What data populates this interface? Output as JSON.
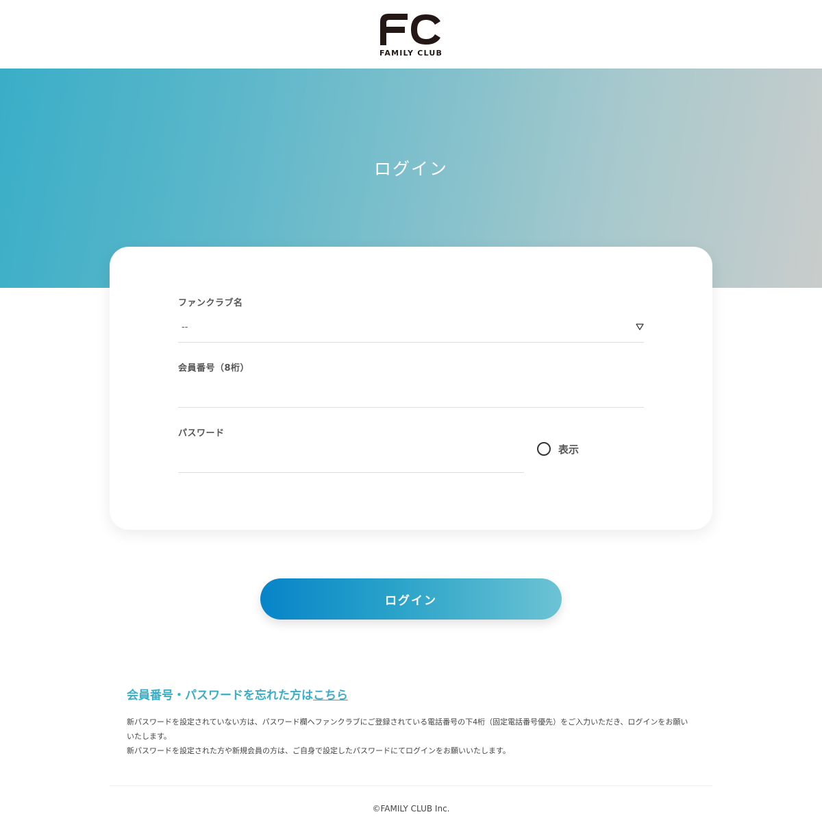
{
  "header": {
    "logo_mark": "FC",
    "logo_text": "FAMILY CLUB"
  },
  "hero": {
    "title": "ログイン"
  },
  "form": {
    "fanclub": {
      "label": "ファンクラブ名",
      "selected_value": "--",
      "icon": "triangle-down-icon"
    },
    "member_number": {
      "label": "会員番号（8桁）",
      "value": "",
      "placeholder": ""
    },
    "password": {
      "label": "パスワード",
      "value": "",
      "placeholder": ""
    },
    "show_password": {
      "label": "表示",
      "checked": false
    }
  },
  "login_button": {
    "label": "ログイン"
  },
  "forgot": {
    "text": "会員番号・パスワードを忘れた方は",
    "link_text": "こちら"
  },
  "notice": {
    "line1": "新パスワードを設定されていない方は、パスワード欄へファンクラブにご登録されている電話番号の下4桁（固定電話番号優先）をご入力いただき、ログインをお願いいたします。",
    "line2": "新パスワードを設定された方や新規会員の方は、ご自身で設定したパスワードにてログインをお願いいたします。"
  },
  "footer": {
    "copyright": "©FAMILY CLUB Inc."
  },
  "colors": {
    "accent": "#3aaec7",
    "button_start": "#0784c9",
    "button_end": "#6cc3d4",
    "hero_start": "#3aaec7",
    "hero_end": "#c9cccb"
  }
}
